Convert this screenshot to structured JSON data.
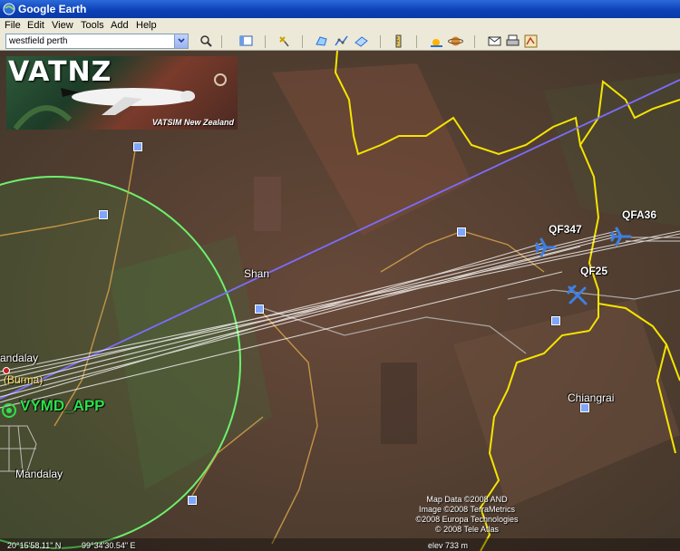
{
  "window": {
    "title": "Google Earth"
  },
  "menu": [
    "File",
    "Edit",
    "View",
    "Tools",
    "Add",
    "Help"
  ],
  "search": {
    "value": "westfield perth"
  },
  "toolbar_icons": [
    "sidebar-toggle-icon",
    "placemark-icon",
    "polygon-icon",
    "path-icon",
    "image-overlay-icon",
    "ruler-icon",
    "sunlight-icon",
    "sky-icon",
    "email-icon",
    "print-icon",
    "google-maps-icon"
  ],
  "logo": {
    "title": "VATNZ",
    "subtitle": "VATSIM New Zealand"
  },
  "map": {
    "places": {
      "shan": "Shan",
      "chiangrai": "Chiangrai",
      "mandalay_top": "andalay",
      "mandalay": "Mandalay",
      "burma": "(Burma)"
    },
    "flights": [
      "QF347",
      "QFA36",
      "QF25"
    ],
    "atc_station": "VYMD_APP"
  },
  "credits": [
    "Map Data ©2008 AND",
    "Image ©2008 TerraMetrics",
    "©2008 Europa Technologies",
    "© 2008 Tele Atlas"
  ],
  "status": {
    "lat": "20°15'58.11\" N",
    "lon": "99°34'30.54\" E",
    "elev": "elev  733 m"
  },
  "colors": {
    "border": "#f5e400",
    "road": "#d6a24a",
    "route": "#ffffff",
    "blue_line": "#7b6cff",
    "atc_ring": "#6cf06c",
    "aircraft": "#3f7fe0"
  }
}
